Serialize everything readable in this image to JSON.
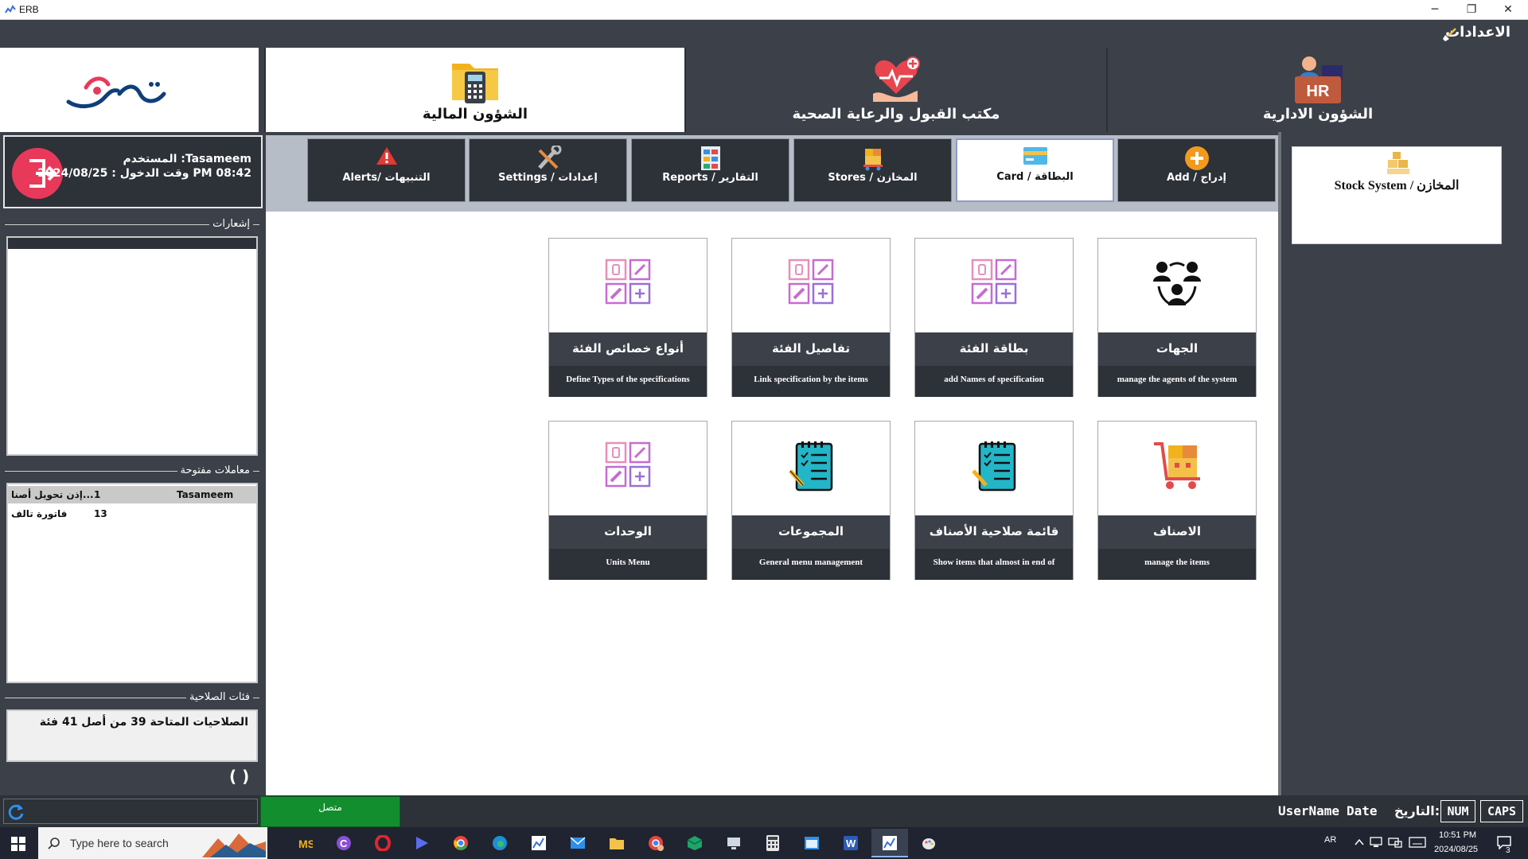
{
  "window": {
    "title": "ERB",
    "controls": [
      "─",
      "❐",
      "✕"
    ]
  },
  "settings_bar": {
    "label": "الاعدادات"
  },
  "modules": [
    {
      "label": "الشؤون المالية",
      "icon": "calculator-folder-icon",
      "active": true
    },
    {
      "label": "مكتب القبول والرعاية الصحية",
      "icon": "health-care-icon",
      "active": false
    },
    {
      "label": "الشؤون الادارية",
      "icon": "hr-icon",
      "active": false
    }
  ],
  "user": {
    "name_line": "المستخدم :Tasameem",
    "login_line": "وقت الدخول : 2024/08/25 PM 08:42"
  },
  "notifications": {
    "title": "إشعارات"
  },
  "open_transactions": {
    "title": "معاملات مفتوحة",
    "rows": [
      {
        "name": "إذن تحويل أصنا...",
        "count": "1",
        "user": "Tasameem"
      },
      {
        "name": "فاتورة تالف",
        "count": "13",
        "user": ""
      }
    ]
  },
  "permissions": {
    "title": "فئات الصلاحية",
    "text": "الصلاحيات المتاحة 39 من أصل 41 فئة"
  },
  "parens": "( )",
  "submenu": [
    {
      "label": "Alerts/ التنبيهات",
      "icon": "alert-icon",
      "active": false
    },
    {
      "label": "Settings / إعدادات",
      "icon": "tools-icon",
      "active": false
    },
    {
      "label": "Reports / التقارير",
      "icon": "reports-icon",
      "active": false
    },
    {
      "label": "Stores / المخازن",
      "icon": "stores-icon",
      "active": false
    },
    {
      "label": "Card / البطاقة",
      "icon": "card-icon",
      "active": true
    },
    {
      "label": "Add / إدراج",
      "icon": "add-icon",
      "active": false
    }
  ],
  "tiles": [
    {
      "title": "أنواع خصائص الفئة",
      "desc": "Define Types of the specifications",
      "icon": "spec-grid-icon"
    },
    {
      "title": "تفاصيل الفئة",
      "desc": "Link specification by the items",
      "icon": "spec-grid-icon"
    },
    {
      "title": "بطاقة الفئة",
      "desc": "add Names of specification",
      "icon": "spec-grid-icon"
    },
    {
      "title": "الجهات",
      "desc": "manage the agents of the system",
      "icon": "agents-icon"
    },
    {
      "title": "الوحدات",
      "desc": "Units Menu",
      "icon": "spec-grid-icon"
    },
    {
      "title": "المجموعات",
      "desc": "General menu management",
      "icon": "checklist-icon"
    },
    {
      "title": "قائمة صلاحية الأصناف",
      "desc": "Show items that almost in end of",
      "icon": "checklist-icon"
    },
    {
      "title": "الاصناف",
      "desc": "manage the items",
      "icon": "cart-boxes-icon"
    }
  ],
  "stock_card": {
    "label": "Stock System / المخازن"
  },
  "statusbar": {
    "connected": "متصل",
    "username": "UserName",
    "date": "Date",
    "date_ar": "التاريخ:",
    "num": "NUM",
    "caps": "CAPS"
  },
  "taskbar": {
    "search_placeholder": "Type here to search",
    "lang": "AR",
    "time": "10:51 PM",
    "date": "2024/08/25",
    "notif_count": "3"
  },
  "colors": {
    "dark": "#3b4049",
    "darker": "#2d3138",
    "accent_green": "#138e2f",
    "logout_pink": "#e8395b"
  }
}
